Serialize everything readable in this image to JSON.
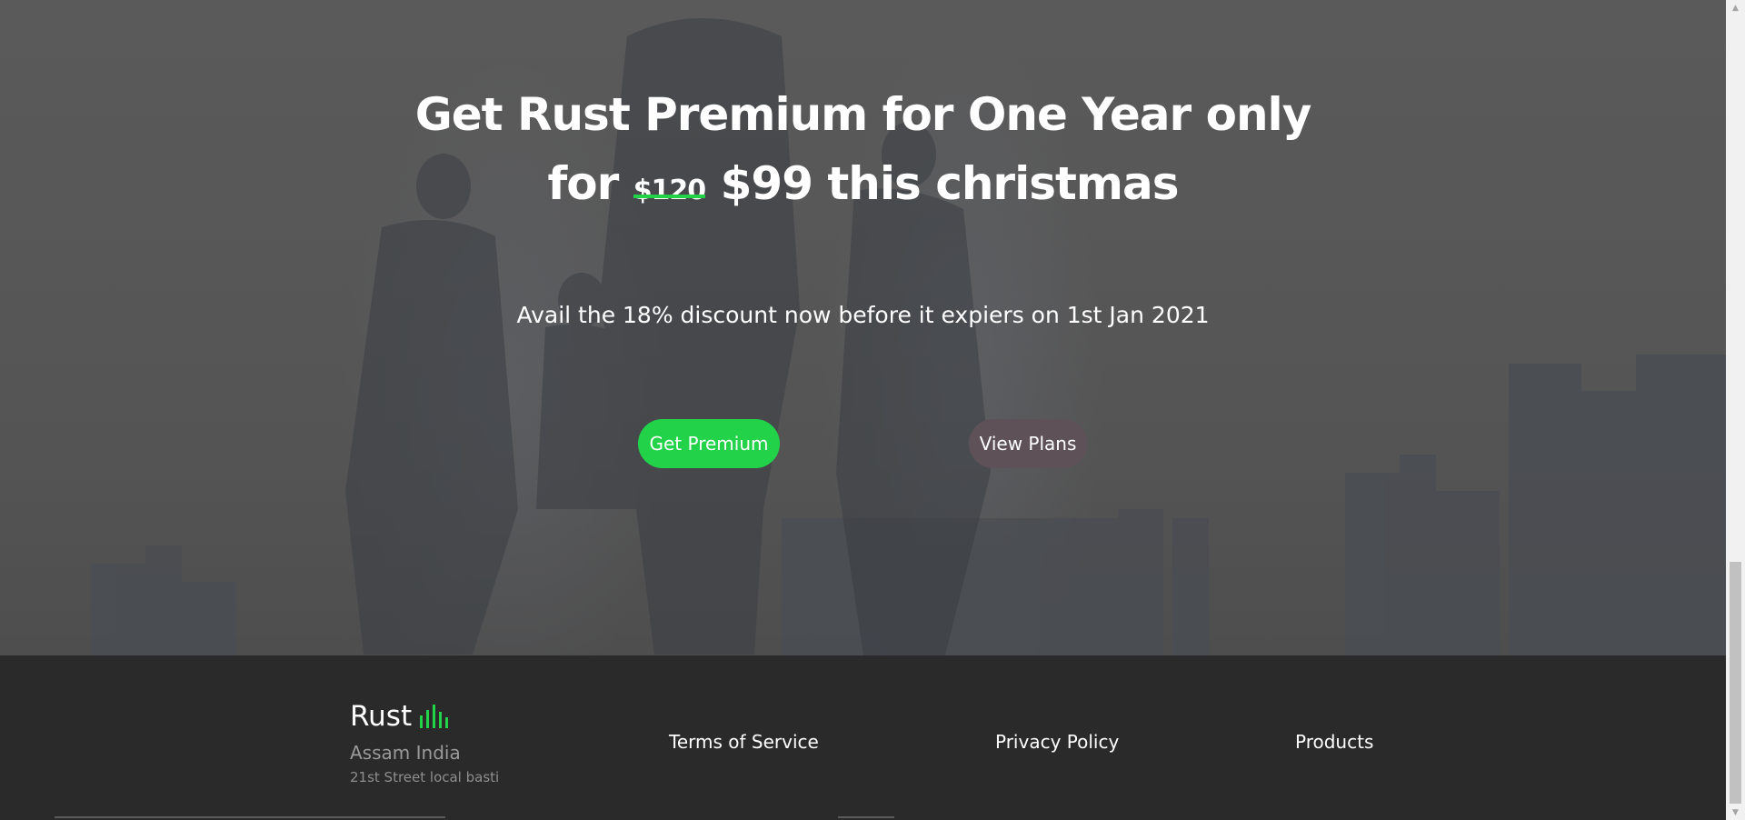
{
  "hero": {
    "headline_line1": "Get Rust Premium for One Year only",
    "headline_for": "for",
    "old_price": "$120",
    "headline_rest": "$99 this christmas",
    "subline": "Avail the 18% discount now before it expiers on 1st Jan 2021",
    "primary_button": "Get Premium",
    "secondary_button": "View Plans"
  },
  "footer": {
    "brand": "Rust",
    "brand_icon": "sound-bars-icon",
    "city": "Assam India",
    "street": "21st Street local basti",
    "links": [
      "Terms of Service",
      "Privacy Policy",
      "Products"
    ]
  },
  "colors": {
    "accent": "#22d34a",
    "footer_bg": "#2a2a2a",
    "secondary_button": "#5e5258"
  },
  "scrollbar": {
    "up_icon": "scroll-up-arrow-icon",
    "down_icon": "scroll-down-arrow-icon"
  }
}
